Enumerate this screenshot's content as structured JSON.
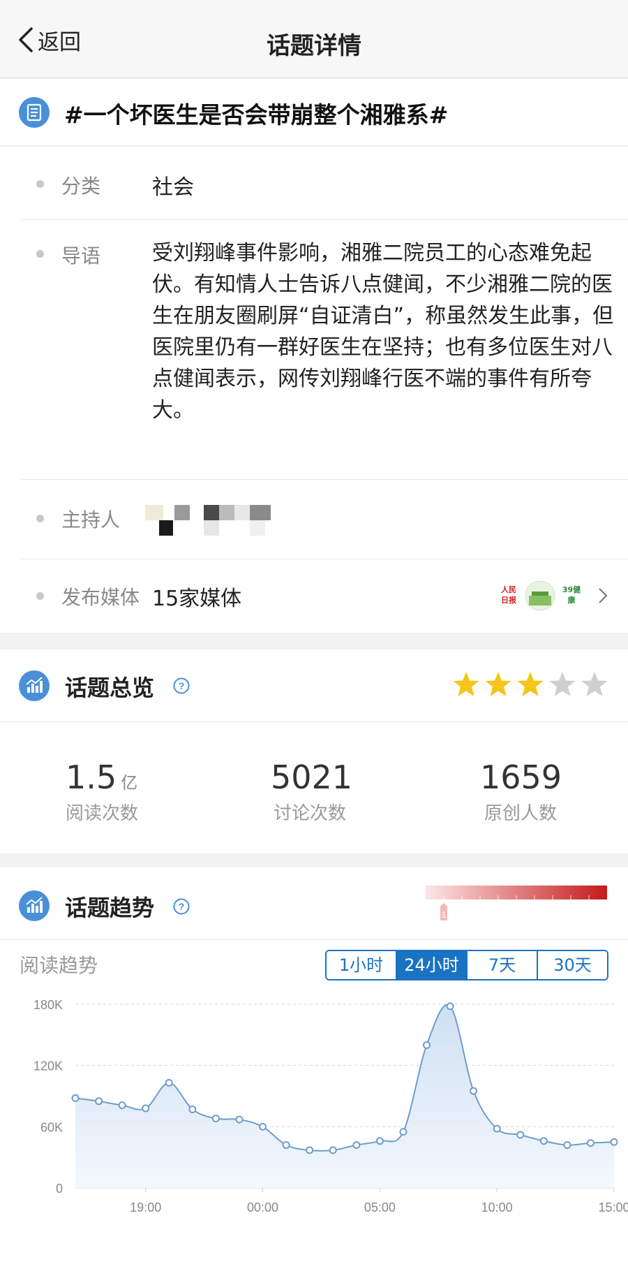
{
  "nav": {
    "back_label": "返回",
    "title": "话题详情"
  },
  "topic": {
    "title": "#一个坏医生是否会带崩整个湘雅系#"
  },
  "info": {
    "category_label": "分类",
    "category_value": "社会",
    "intro_label": "导语",
    "intro_text": "受刘翔峰事件影响，湘雅二院员工的心态难免起伏。有知情人士告诉八点健闻，不少湘雅二院的医生在朋友圈刷屏“自证清白”，称虽然发生此事，但医院里仍有一群好医生在坚持；也有多位医生对八点健闻表示，网传刘翔峰行医不端的事件有所夸大。",
    "host_label": "主持人",
    "media_label": "发布媒体",
    "media_value": "15家媒体",
    "media_logo_1": "人民日报",
    "media_logo_3": "39健康"
  },
  "overview": {
    "title": "话题总览",
    "rating": 3,
    "rating_max": 5,
    "reads_value": "1.5",
    "reads_unit": "亿",
    "reads_label": "阅读次数",
    "discussions_value": "5021",
    "discussions_label": "讨论次数",
    "originals_value": "1659",
    "originals_label": "原创人数"
  },
  "trend": {
    "title": "话题趋势",
    "heat_marker": "1",
    "subtitle": "阅读趋势",
    "tabs": [
      "1小时",
      "24小时",
      "7天",
      "30天"
    ],
    "active_tab": "24小时"
  },
  "colors": {
    "accent": "#1a73c2",
    "star_on": "#f5c518",
    "star_off": "#cfcfcf",
    "line": "#6f9ccc",
    "heat_start": "#fde6e6",
    "heat_end": "#c51a1a"
  },
  "chart_data": {
    "type": "area",
    "y_ticks": [
      "180K",
      "120K",
      "60K",
      "0"
    ],
    "ylim": [
      0,
      180000
    ],
    "x_tick_labels": [
      "19:00",
      "00:00",
      "05:00",
      "10:00",
      "15:00"
    ],
    "x_tick_hours": [
      19,
      24,
      29,
      34,
      39
    ],
    "x_hours": [
      16,
      17,
      18,
      19,
      20,
      21,
      22,
      23,
      24,
      25,
      26,
      27,
      28,
      29,
      30,
      31,
      32,
      33,
      34,
      35,
      36,
      37,
      38,
      39
    ],
    "series": [
      {
        "values": [
          88000,
          85000,
          81000,
          78000,
          103000,
          77000,
          68000,
          67000,
          60000,
          42000,
          37000,
          37000,
          42000,
          46000,
          55000,
          140000,
          178000,
          95000,
          58000,
          52000,
          46000,
          42000,
          44000,
          45000
        ]
      }
    ]
  }
}
